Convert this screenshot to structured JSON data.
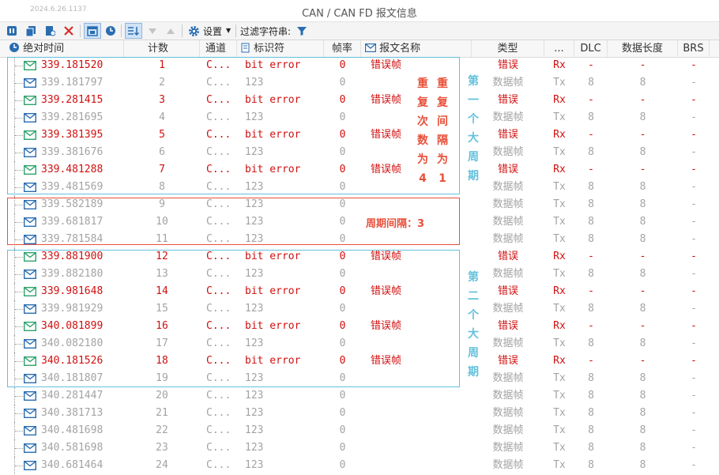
{
  "window": {
    "date": "2024.6.26.1137",
    "title": "CAN / CAN FD 报文信息"
  },
  "toolbar": {
    "settings_label": "设置",
    "filter_label": "过滤字符串:"
  },
  "columns": [
    "绝对时间",
    "计数",
    "通道",
    "标识符",
    "帧率",
    "报文名称",
    "类型",
    "...",
    "DLC",
    "数据长度",
    "BRS"
  ],
  "rows": [
    {
      "time": "339.181520",
      "count": "1",
      "channel": "C...",
      "id": "bit error",
      "rate": "0",
      "name": "错误帧",
      "type": "错误",
      "dir": "Rx",
      "dlc": "-",
      "len": "-",
      "brs": "-",
      "err": true
    },
    {
      "time": "339.181797",
      "count": "2",
      "channel": "C...",
      "id": "123",
      "rate": "0",
      "name": "",
      "type": "数据帧",
      "dir": "Tx",
      "dlc": "8",
      "len": "8",
      "brs": "-",
      "err": false
    },
    {
      "time": "339.281415",
      "count": "3",
      "channel": "C...",
      "id": "bit error",
      "rate": "0",
      "name": "错误帧",
      "type": "错误",
      "dir": "Rx",
      "dlc": "-",
      "len": "-",
      "brs": "-",
      "err": true
    },
    {
      "time": "339.281695",
      "count": "4",
      "channel": "C...",
      "id": "123",
      "rate": "0",
      "name": "",
      "type": "数据帧",
      "dir": "Tx",
      "dlc": "8",
      "len": "8",
      "brs": "-",
      "err": false
    },
    {
      "time": "339.381395",
      "count": "5",
      "channel": "C...",
      "id": "bit error",
      "rate": "0",
      "name": "错误帧",
      "type": "错误",
      "dir": "Rx",
      "dlc": "-",
      "len": "-",
      "brs": "-",
      "err": true
    },
    {
      "time": "339.381676",
      "count": "6",
      "channel": "C...",
      "id": "123",
      "rate": "0",
      "name": "",
      "type": "数据帧",
      "dir": "Tx",
      "dlc": "8",
      "len": "8",
      "brs": "-",
      "err": false
    },
    {
      "time": "339.481288",
      "count": "7",
      "channel": "C...",
      "id": "bit error",
      "rate": "0",
      "name": "错误帧",
      "type": "错误",
      "dir": "Rx",
      "dlc": "-",
      "len": "-",
      "brs": "-",
      "err": true
    },
    {
      "time": "339.481569",
      "count": "8",
      "channel": "C...",
      "id": "123",
      "rate": "0",
      "name": "",
      "type": "数据帧",
      "dir": "Tx",
      "dlc": "8",
      "len": "8",
      "brs": "-",
      "err": false
    },
    {
      "time": "339.582189",
      "count": "9",
      "channel": "C...",
      "id": "123",
      "rate": "0",
      "name": "",
      "type": "数据帧",
      "dir": "Tx",
      "dlc": "8",
      "len": "8",
      "brs": "-",
      "err": false
    },
    {
      "time": "339.681817",
      "count": "10",
      "channel": "C...",
      "id": "123",
      "rate": "0",
      "name": "",
      "type": "数据帧",
      "dir": "Tx",
      "dlc": "8",
      "len": "8",
      "brs": "-",
      "err": false
    },
    {
      "time": "339.781584",
      "count": "11",
      "channel": "C...",
      "id": "123",
      "rate": "0",
      "name": "",
      "type": "数据帧",
      "dir": "Tx",
      "dlc": "8",
      "len": "8",
      "brs": "-",
      "err": false
    },
    {
      "time": "339.881900",
      "count": "12",
      "channel": "C...",
      "id": "bit error",
      "rate": "0",
      "name": "错误帧",
      "type": "错误",
      "dir": "Rx",
      "dlc": "-",
      "len": "-",
      "brs": "-",
      "err": true
    },
    {
      "time": "339.882180",
      "count": "13",
      "channel": "C...",
      "id": "123",
      "rate": "0",
      "name": "",
      "type": "数据帧",
      "dir": "Tx",
      "dlc": "8",
      "len": "8",
      "brs": "-",
      "err": false
    },
    {
      "time": "339.981648",
      "count": "14",
      "channel": "C...",
      "id": "bit error",
      "rate": "0",
      "name": "错误帧",
      "type": "错误",
      "dir": "Rx",
      "dlc": "-",
      "len": "-",
      "brs": "-",
      "err": true
    },
    {
      "time": "339.981929",
      "count": "15",
      "channel": "C...",
      "id": "123",
      "rate": "0",
      "name": "",
      "type": "数据帧",
      "dir": "Tx",
      "dlc": "8",
      "len": "8",
      "brs": "-",
      "err": false
    },
    {
      "time": "340.081899",
      "count": "16",
      "channel": "C...",
      "id": "bit error",
      "rate": "0",
      "name": "错误帧",
      "type": "错误",
      "dir": "Rx",
      "dlc": "-",
      "len": "-",
      "brs": "-",
      "err": true
    },
    {
      "time": "340.082180",
      "count": "17",
      "channel": "C...",
      "id": "123",
      "rate": "0",
      "name": "",
      "type": "数据帧",
      "dir": "Tx",
      "dlc": "8",
      "len": "8",
      "brs": "-",
      "err": false
    },
    {
      "time": "340.181526",
      "count": "18",
      "channel": "C...",
      "id": "bit error",
      "rate": "0",
      "name": "错误帧",
      "type": "错误",
      "dir": "Rx",
      "dlc": "-",
      "len": "-",
      "brs": "-",
      "err": true
    },
    {
      "time": "340.181807",
      "count": "19",
      "channel": "C...",
      "id": "123",
      "rate": "0",
      "name": "",
      "type": "数据帧",
      "dir": "Tx",
      "dlc": "8",
      "len": "8",
      "brs": "-",
      "err": false
    },
    {
      "time": "340.281447",
      "count": "20",
      "channel": "C...",
      "id": "123",
      "rate": "0",
      "name": "",
      "type": "数据帧",
      "dir": "Tx",
      "dlc": "8",
      "len": "8",
      "brs": "-",
      "err": false
    },
    {
      "time": "340.381713",
      "count": "21",
      "channel": "C...",
      "id": "123",
      "rate": "0",
      "name": "",
      "type": "数据帧",
      "dir": "Tx",
      "dlc": "8",
      "len": "8",
      "brs": "-",
      "err": false
    },
    {
      "time": "340.481698",
      "count": "22",
      "channel": "C...",
      "id": "123",
      "rate": "0",
      "name": "",
      "type": "数据帧",
      "dir": "Tx",
      "dlc": "8",
      "len": "8",
      "brs": "-",
      "err": false
    },
    {
      "time": "340.581698",
      "count": "23",
      "channel": "C...",
      "id": "123",
      "rate": "0",
      "name": "",
      "type": "数据帧",
      "dir": "Tx",
      "dlc": "8",
      "len": "8",
      "brs": "-",
      "err": false
    },
    {
      "time": "340.681464",
      "count": "24",
      "channel": "C...",
      "id": "123",
      "rate": "0",
      "name": "",
      "type": "数据帧",
      "dir": "Tx",
      "dlc": "8",
      "len": "8",
      "brs": "-",
      "err": false
    }
  ],
  "annotations": {
    "repeat_count": "重复次数为4",
    "repeat_interval": "重复间隔为1",
    "cycle_gap": "周期间隔：3",
    "first_cycle": "第一个大周期",
    "second_cycle": "第二个大周期"
  },
  "colors": {
    "error_red": "#d10f0f",
    "gray_text": "#a3a3a3",
    "annotation_blue": "#63c1dc",
    "annotation_red": "#e8503a",
    "error_envelope": "#2ea36b",
    "data_envelope": "#2a6db0"
  }
}
